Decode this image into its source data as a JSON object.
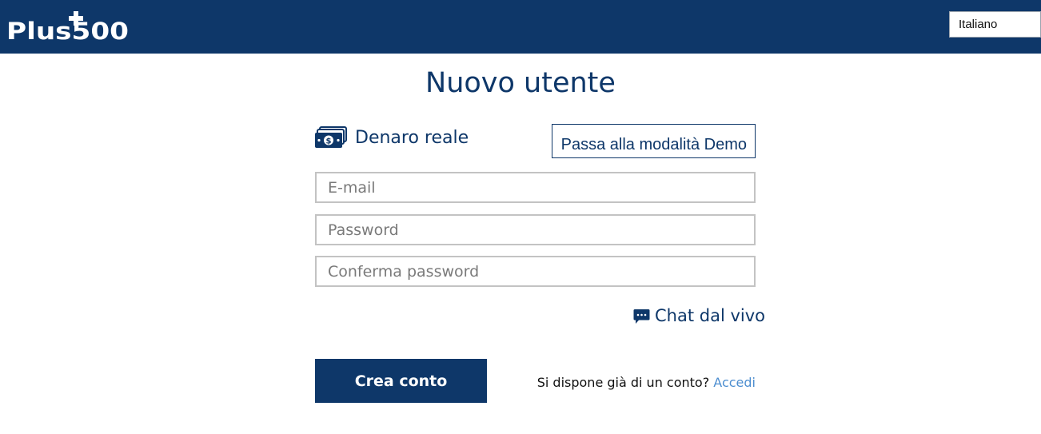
{
  "header": {
    "logo_text": "Plus500",
    "language": "Italiano"
  },
  "form": {
    "title": "Nuovo utente",
    "mode_label": "Denaro reale",
    "demo_button": "Passa alla modalità Demo",
    "email_placeholder": "E-mail",
    "password_placeholder": "Password",
    "confirm_placeholder": "Conferma password",
    "chat_label": "Chat dal vivo",
    "create_button": "Crea conto",
    "login_prompt": "Si dispone già di un conto?",
    "login_link": "Accedi"
  },
  "colors": {
    "brand_navy": "#0e3769",
    "link_blue": "#4d8ed0",
    "field_border": "#c3c3c3"
  },
  "icons": [
    "money-icon",
    "chat-icon"
  ]
}
